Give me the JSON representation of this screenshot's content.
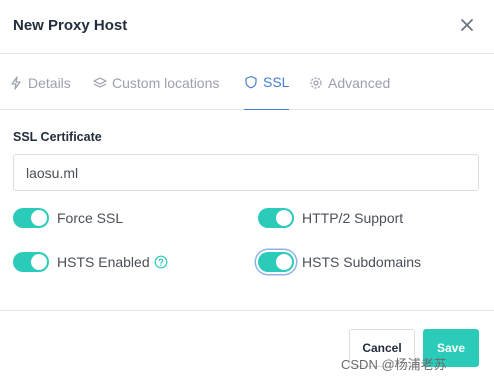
{
  "modal": {
    "title": "New Proxy Host"
  },
  "tabs": [
    {
      "label": "Details",
      "icon": "zap-icon"
    },
    {
      "label": "Custom locations",
      "icon": "layers-icon"
    },
    {
      "label": "SSL",
      "icon": "shield-icon",
      "active": true
    },
    {
      "label": "Advanced",
      "icon": "gear-icon"
    }
  ],
  "ssl": {
    "certificate_label": "SSL Certificate",
    "certificate_value": "laosu.ml",
    "toggles": [
      {
        "label": "Force SSL",
        "on": true
      },
      {
        "label": "HTTP/2 Support",
        "on": true
      },
      {
        "label": "HSTS Enabled",
        "on": true
      },
      {
        "label": "HSTS Subdomains",
        "on": true
      }
    ]
  },
  "footer": {
    "cancel_label": "Cancel",
    "save_label": "Save"
  },
  "watermark": "CSDN @杨浦老苏",
  "colors": {
    "accent": "#2bcbba",
    "tab_active": "#467fcf",
    "text": "#232e3c"
  }
}
